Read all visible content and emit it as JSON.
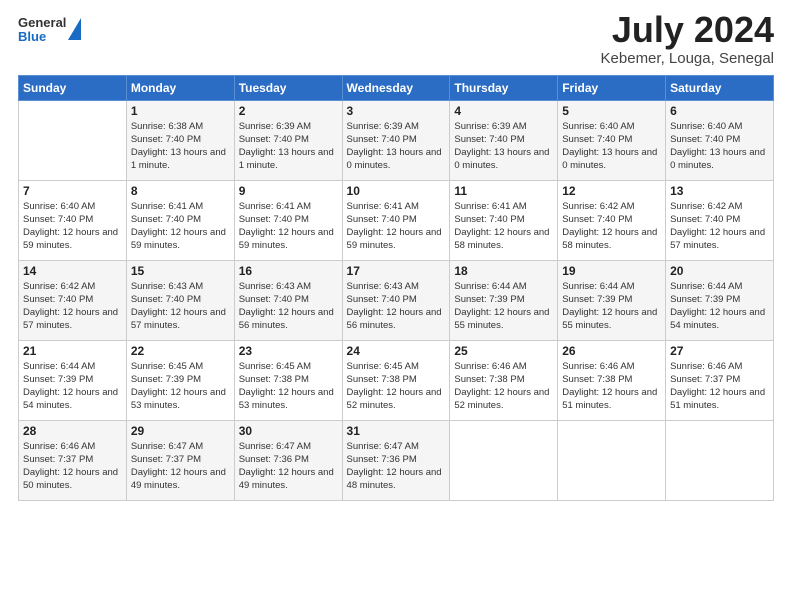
{
  "logo": {
    "general": "General",
    "blue": "Blue"
  },
  "title": {
    "month_year": "July 2024",
    "location": "Kebemer, Louga, Senegal"
  },
  "days_of_week": [
    "Sunday",
    "Monday",
    "Tuesday",
    "Wednesday",
    "Thursday",
    "Friday",
    "Saturday"
  ],
  "weeks": [
    [
      {
        "day": "",
        "sunrise": "",
        "sunset": "",
        "daylight": ""
      },
      {
        "day": "1",
        "sunrise": "Sunrise: 6:38 AM",
        "sunset": "Sunset: 7:40 PM",
        "daylight": "Daylight: 13 hours and 1 minute."
      },
      {
        "day": "2",
        "sunrise": "Sunrise: 6:39 AM",
        "sunset": "Sunset: 7:40 PM",
        "daylight": "Daylight: 13 hours and 1 minute."
      },
      {
        "day": "3",
        "sunrise": "Sunrise: 6:39 AM",
        "sunset": "Sunset: 7:40 PM",
        "daylight": "Daylight: 13 hours and 0 minutes."
      },
      {
        "day": "4",
        "sunrise": "Sunrise: 6:39 AM",
        "sunset": "Sunset: 7:40 PM",
        "daylight": "Daylight: 13 hours and 0 minutes."
      },
      {
        "day": "5",
        "sunrise": "Sunrise: 6:40 AM",
        "sunset": "Sunset: 7:40 PM",
        "daylight": "Daylight: 13 hours and 0 minutes."
      },
      {
        "day": "6",
        "sunrise": "Sunrise: 6:40 AM",
        "sunset": "Sunset: 7:40 PM",
        "daylight": "Daylight: 13 hours and 0 minutes."
      }
    ],
    [
      {
        "day": "7",
        "sunrise": "Sunrise: 6:40 AM",
        "sunset": "Sunset: 7:40 PM",
        "daylight": "Daylight: 12 hours and 59 minutes."
      },
      {
        "day": "8",
        "sunrise": "Sunrise: 6:41 AM",
        "sunset": "Sunset: 7:40 PM",
        "daylight": "Daylight: 12 hours and 59 minutes."
      },
      {
        "day": "9",
        "sunrise": "Sunrise: 6:41 AM",
        "sunset": "Sunset: 7:40 PM",
        "daylight": "Daylight: 12 hours and 59 minutes."
      },
      {
        "day": "10",
        "sunrise": "Sunrise: 6:41 AM",
        "sunset": "Sunset: 7:40 PM",
        "daylight": "Daylight: 12 hours and 59 minutes."
      },
      {
        "day": "11",
        "sunrise": "Sunrise: 6:41 AM",
        "sunset": "Sunset: 7:40 PM",
        "daylight": "Daylight: 12 hours and 58 minutes."
      },
      {
        "day": "12",
        "sunrise": "Sunrise: 6:42 AM",
        "sunset": "Sunset: 7:40 PM",
        "daylight": "Daylight: 12 hours and 58 minutes."
      },
      {
        "day": "13",
        "sunrise": "Sunrise: 6:42 AM",
        "sunset": "Sunset: 7:40 PM",
        "daylight": "Daylight: 12 hours and 57 minutes."
      }
    ],
    [
      {
        "day": "14",
        "sunrise": "Sunrise: 6:42 AM",
        "sunset": "Sunset: 7:40 PM",
        "daylight": "Daylight: 12 hours and 57 minutes."
      },
      {
        "day": "15",
        "sunrise": "Sunrise: 6:43 AM",
        "sunset": "Sunset: 7:40 PM",
        "daylight": "Daylight: 12 hours and 57 minutes."
      },
      {
        "day": "16",
        "sunrise": "Sunrise: 6:43 AM",
        "sunset": "Sunset: 7:40 PM",
        "daylight": "Daylight: 12 hours and 56 minutes."
      },
      {
        "day": "17",
        "sunrise": "Sunrise: 6:43 AM",
        "sunset": "Sunset: 7:40 PM",
        "daylight": "Daylight: 12 hours and 56 minutes."
      },
      {
        "day": "18",
        "sunrise": "Sunrise: 6:44 AM",
        "sunset": "Sunset: 7:39 PM",
        "daylight": "Daylight: 12 hours and 55 minutes."
      },
      {
        "day": "19",
        "sunrise": "Sunrise: 6:44 AM",
        "sunset": "Sunset: 7:39 PM",
        "daylight": "Daylight: 12 hours and 55 minutes."
      },
      {
        "day": "20",
        "sunrise": "Sunrise: 6:44 AM",
        "sunset": "Sunset: 7:39 PM",
        "daylight": "Daylight: 12 hours and 54 minutes."
      }
    ],
    [
      {
        "day": "21",
        "sunrise": "Sunrise: 6:44 AM",
        "sunset": "Sunset: 7:39 PM",
        "daylight": "Daylight: 12 hours and 54 minutes."
      },
      {
        "day": "22",
        "sunrise": "Sunrise: 6:45 AM",
        "sunset": "Sunset: 7:39 PM",
        "daylight": "Daylight: 12 hours and 53 minutes."
      },
      {
        "day": "23",
        "sunrise": "Sunrise: 6:45 AM",
        "sunset": "Sunset: 7:38 PM",
        "daylight": "Daylight: 12 hours and 53 minutes."
      },
      {
        "day": "24",
        "sunrise": "Sunrise: 6:45 AM",
        "sunset": "Sunset: 7:38 PM",
        "daylight": "Daylight: 12 hours and 52 minutes."
      },
      {
        "day": "25",
        "sunrise": "Sunrise: 6:46 AM",
        "sunset": "Sunset: 7:38 PM",
        "daylight": "Daylight: 12 hours and 52 minutes."
      },
      {
        "day": "26",
        "sunrise": "Sunrise: 6:46 AM",
        "sunset": "Sunset: 7:38 PM",
        "daylight": "Daylight: 12 hours and 51 minutes."
      },
      {
        "day": "27",
        "sunrise": "Sunrise: 6:46 AM",
        "sunset": "Sunset: 7:37 PM",
        "daylight": "Daylight: 12 hours and 51 minutes."
      }
    ],
    [
      {
        "day": "28",
        "sunrise": "Sunrise: 6:46 AM",
        "sunset": "Sunset: 7:37 PM",
        "daylight": "Daylight: 12 hours and 50 minutes."
      },
      {
        "day": "29",
        "sunrise": "Sunrise: 6:47 AM",
        "sunset": "Sunset: 7:37 PM",
        "daylight": "Daylight: 12 hours and 49 minutes."
      },
      {
        "day": "30",
        "sunrise": "Sunrise: 6:47 AM",
        "sunset": "Sunset: 7:36 PM",
        "daylight": "Daylight: 12 hours and 49 minutes."
      },
      {
        "day": "31",
        "sunrise": "Sunrise: 6:47 AM",
        "sunset": "Sunset: 7:36 PM",
        "daylight": "Daylight: 12 hours and 48 minutes."
      },
      {
        "day": "",
        "sunrise": "",
        "sunset": "",
        "daylight": ""
      },
      {
        "day": "",
        "sunrise": "",
        "sunset": "",
        "daylight": ""
      },
      {
        "day": "",
        "sunrise": "",
        "sunset": "",
        "daylight": ""
      }
    ]
  ]
}
